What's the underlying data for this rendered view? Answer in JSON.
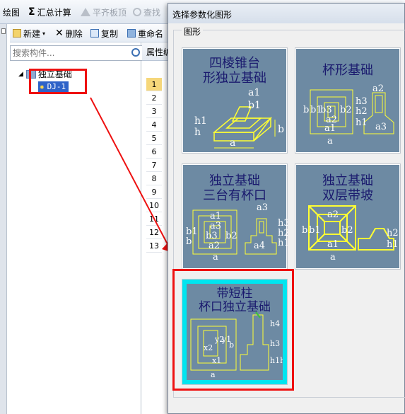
{
  "toolbar": {
    "draw_label": "绘图",
    "sum_label": "汇总计算",
    "align_label": "平齐板顶",
    "find_label": "查找"
  },
  "edit_toolbar": {
    "new_label": "新建",
    "delete_label": "删除",
    "copy_label": "复制",
    "rename_label": "重命名"
  },
  "search": {
    "placeholder": "搜索构件..."
  },
  "tree": {
    "root_label": "独立基础",
    "child_label": "DJ-1"
  },
  "properties": {
    "header": "属性编辑",
    "row_numbers": [
      "1",
      "2",
      "3",
      "4",
      "5",
      "6",
      "7",
      "8",
      "9",
      "10",
      "11",
      "12",
      "13"
    ]
  },
  "dialog": {
    "title": "选择参数化图形",
    "group_label": "图形",
    "tiles": [
      {
        "title_line1": "四棱锥台",
        "title_line2": "形独立基础"
      },
      {
        "title_line1": "杯形基础",
        "title_line2": ""
      },
      {
        "title_line1": "独立基础",
        "title_line2": "三台有杯口"
      },
      {
        "title_line1": "独立基础",
        "title_line2": "双层带坡"
      },
      {
        "title_line1": "带短柱",
        "title_line2": "杯口独立基础"
      }
    ]
  },
  "colors": {
    "tile_bg": "#6d8aa3",
    "tile_line": "#ffff33",
    "selected_tile": "#00e5f0",
    "highlight": "#e11111",
    "selected_row": "#f6d77a"
  }
}
